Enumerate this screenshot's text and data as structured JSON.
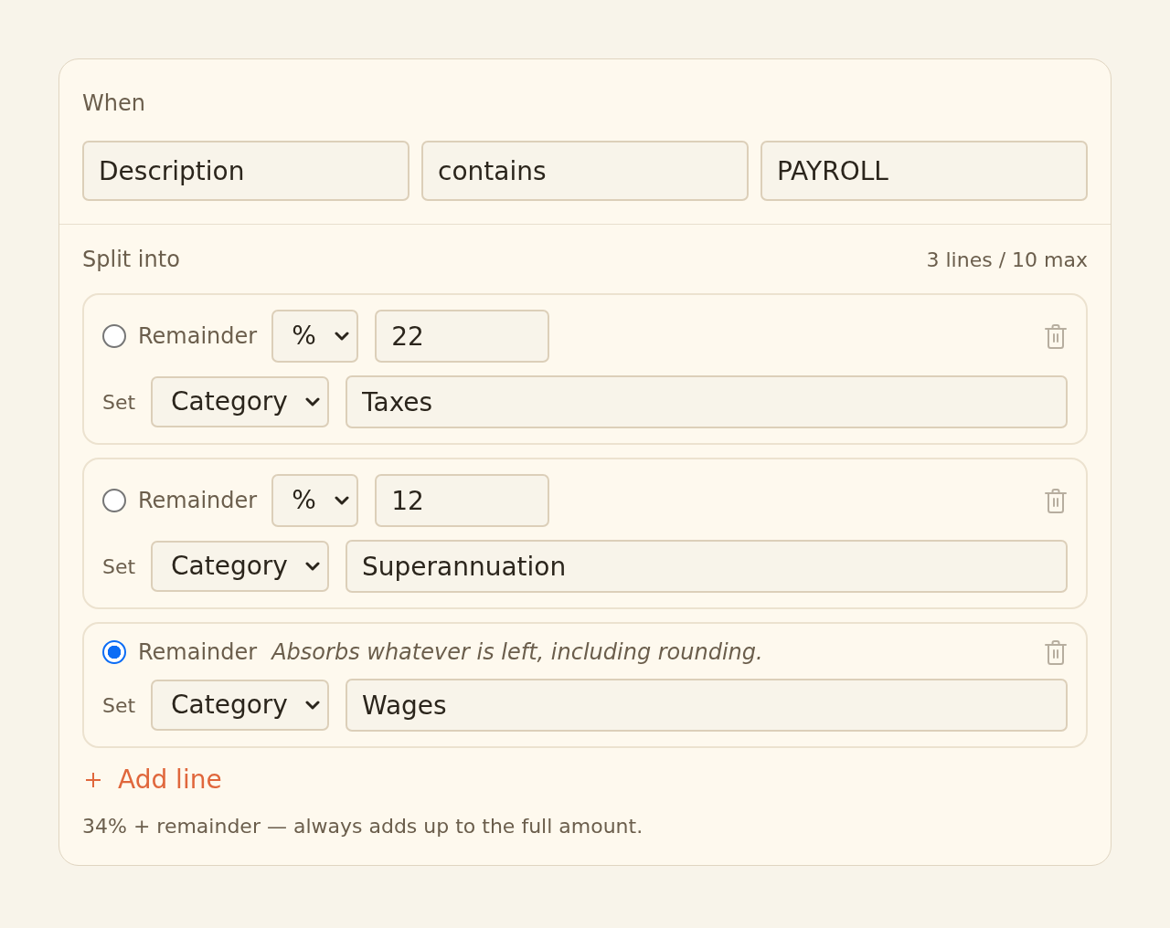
{
  "when": {
    "label": "When",
    "field": {
      "value": "Description"
    },
    "operator": {
      "value": "contains"
    },
    "match": {
      "value": "PAYROLL"
    }
  },
  "split": {
    "label": "Split into",
    "count": "3 lines / 10 max",
    "lines": [
      {
        "selected": false,
        "radio_label": "Remainder",
        "unit": "%",
        "amount": "22",
        "set_label": "Set",
        "target": "Category",
        "value": "Taxes"
      },
      {
        "selected": false,
        "radio_label": "Remainder",
        "unit": "%",
        "amount": "12",
        "set_label": "Set",
        "target": "Category",
        "value": "Superannuation"
      },
      {
        "selected": true,
        "radio_label": "Remainder",
        "note": "Absorbs whatever is left, including rounding.",
        "set_label": "Set",
        "target": "Category",
        "value": "Wages"
      }
    ]
  },
  "add_line": {
    "label": "Add line"
  },
  "summary": "34% + remainder — always adds up to the full amount."
}
